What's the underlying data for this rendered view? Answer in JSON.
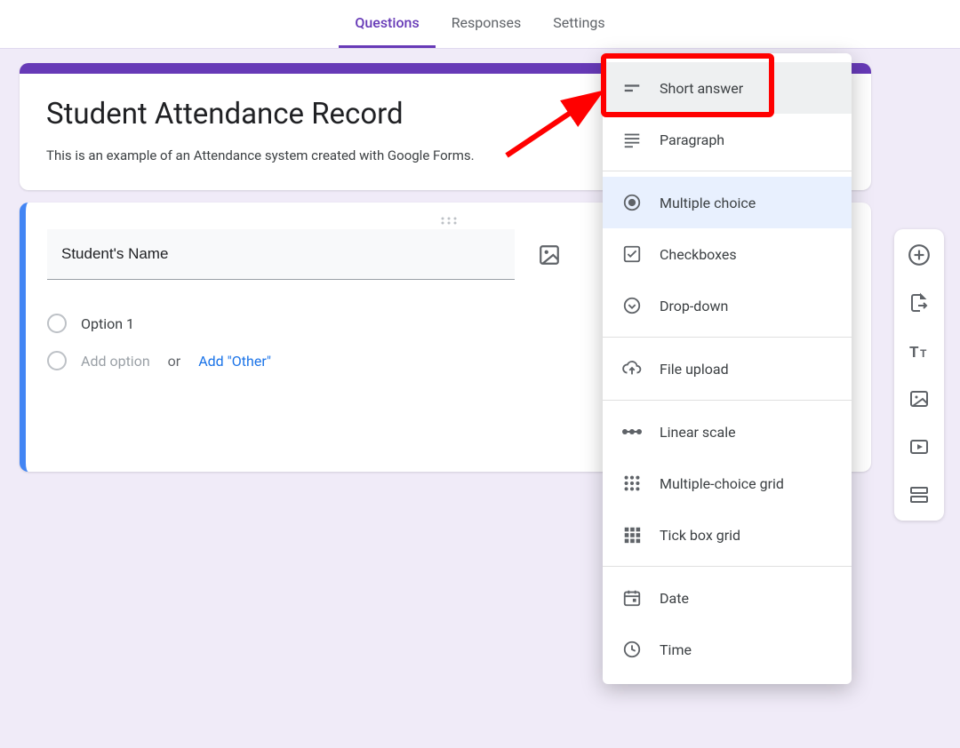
{
  "tabs": {
    "questions": "Questions",
    "responses": "Responses",
    "settings": "Settings"
  },
  "title_card": {
    "title": "Student Attendance Record",
    "description": "This is an example of an Attendance system created with Google Forms."
  },
  "question": {
    "title": "Student's Name",
    "option1": "Option 1",
    "add_option": "Add option",
    "or": "or",
    "add_other": "Add \"Other\""
  },
  "qtype_menu": {
    "short_answer": "Short answer",
    "paragraph": "Paragraph",
    "multiple_choice": "Multiple choice",
    "checkboxes": "Checkboxes",
    "dropdown": "Drop-down",
    "file_upload": "File upload",
    "linear_scale": "Linear scale",
    "mc_grid": "Multiple-choice grid",
    "tick_grid": "Tick box grid",
    "date": "Date",
    "time": "Time"
  }
}
